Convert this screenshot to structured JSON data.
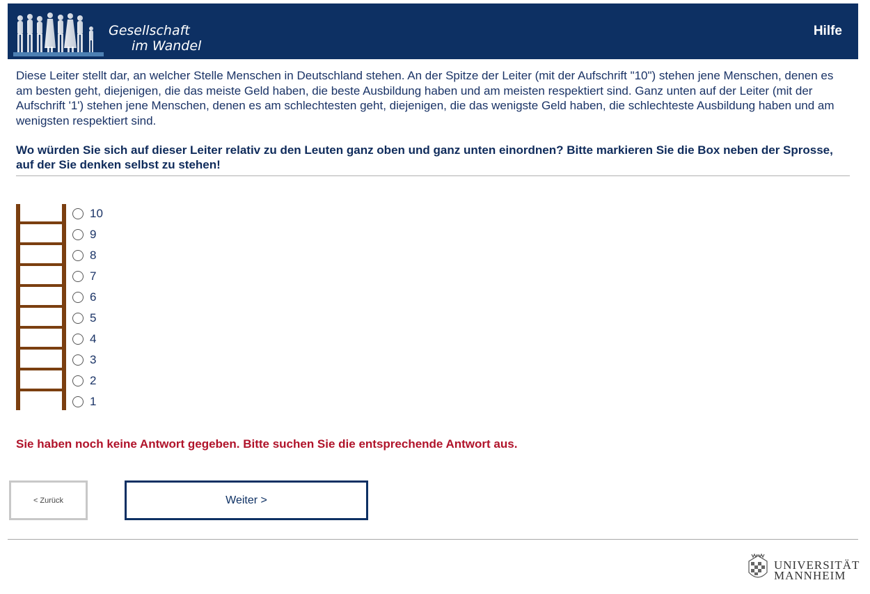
{
  "header": {
    "logo_line1": "Gesellschaft",
    "logo_line2": "im Wandel",
    "help_label": "Hilfe",
    "background_color": "#0d3063"
  },
  "intro_text": "Diese Leiter stellt dar, an welcher Stelle Menschen in Deutschland stehen. An der Spitze der Leiter (mit der Aufschrift \"10\") stehen jene Menschen, denen es am besten geht, diejenigen, die das meiste Geld haben, die beste Ausbildung haben und am meisten respektiert sind. Ganz unten auf der Leiter (mit der Aufschrift '1') stehen jene Menschen, denen es am schlechtesten geht, diejenigen, die das wenigste Geld haben, die schlechteste Ausbildung haben und am wenigsten respektiert sind.",
  "question_text": "Wo würden Sie sich auf dieser Leiter relativ zu den Leuten ganz oben und ganz unten einordnen? Bitte markieren Sie die Box neben der Sprosse, auf der Sie denken selbst zu stehen!",
  "options": [
    {
      "label": "10",
      "checked": false
    },
    {
      "label": "9",
      "checked": false
    },
    {
      "label": "8",
      "checked": false
    },
    {
      "label": "7",
      "checked": false
    },
    {
      "label": "6",
      "checked": false
    },
    {
      "label": "5",
      "checked": false
    },
    {
      "label": "4",
      "checked": false
    },
    {
      "label": "3",
      "checked": false
    },
    {
      "label": "2",
      "checked": false
    },
    {
      "label": "1",
      "checked": false
    }
  ],
  "ladder_color": "#7b3f10",
  "error_message": "Sie haben noch keine Antwort gegeben. Bitte suchen Sie die entsprechende Antwort aus.",
  "error_color": "#b0132a",
  "nav": {
    "back_label": "< Zurück",
    "next_label": "Weiter >"
  },
  "footer": {
    "university_line1": "UNIVERSITÄT",
    "university_line2": "MANNHEIM"
  }
}
